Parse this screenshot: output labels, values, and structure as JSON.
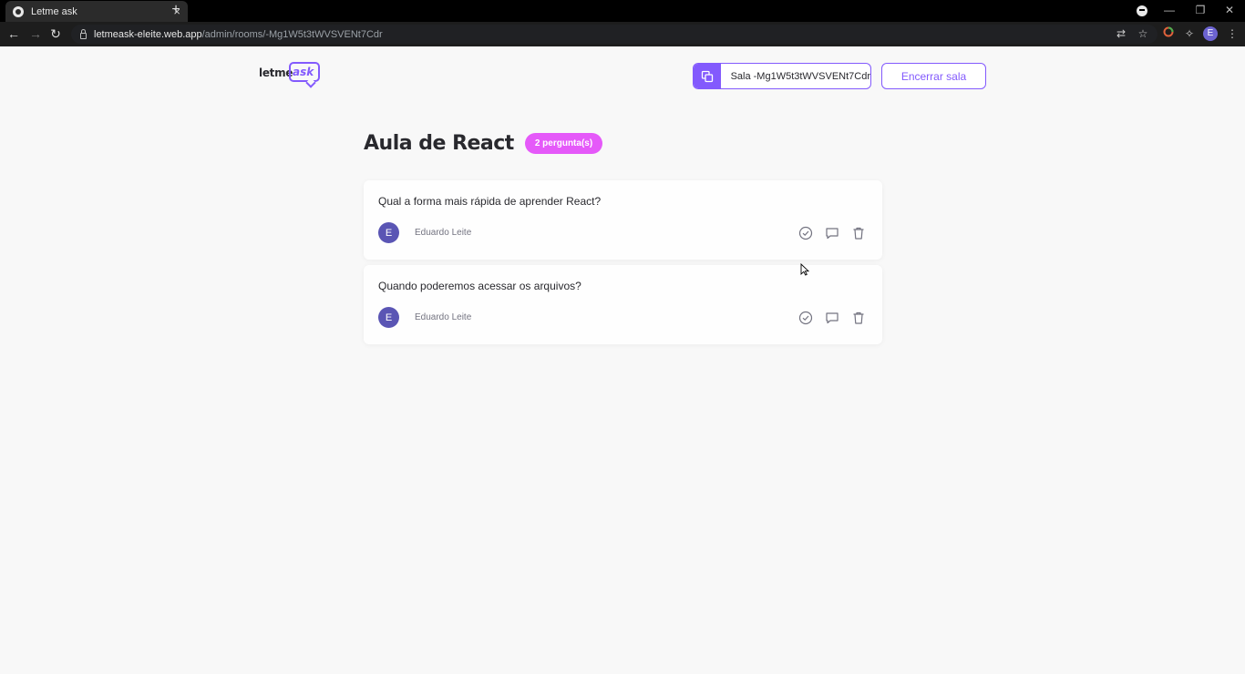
{
  "browser": {
    "tab_title": "Letme ask",
    "tab_close": "×",
    "new_tab": "+",
    "url_host": "letmeask-eleite.web.app",
    "url_path": "/admin/rooms/-Mg1W5t3tWVSVENt7Cdr",
    "profile_initial": "E"
  },
  "header": {
    "logo_text_1": "letme",
    "logo_text_2": "ask",
    "room_code_label": "Sala -Mg1W5t3tWVSVENt7Cdr",
    "close_room_label": "Encerrar sala"
  },
  "room": {
    "title": "Aula de React",
    "question_count_label": "2 pergunta(s)"
  },
  "questions": [
    {
      "content": "Qual a forma mais rápida de aprender React?",
      "author_initial": "E",
      "author_name": "Eduardo Leite"
    },
    {
      "content": "Quando poderemos acessar os arquivos?",
      "author_initial": "E",
      "author_name": "Eduardo Leite"
    }
  ],
  "colors": {
    "primary": "#835afd",
    "badge": "#e559f9",
    "background": "#f8f8f8",
    "text": "#29292e",
    "muted": "#737380"
  },
  "icons": {
    "copy": "copy-icon",
    "check": "check-circle-icon",
    "answer": "chat-bubble-icon",
    "delete": "trash-icon"
  }
}
